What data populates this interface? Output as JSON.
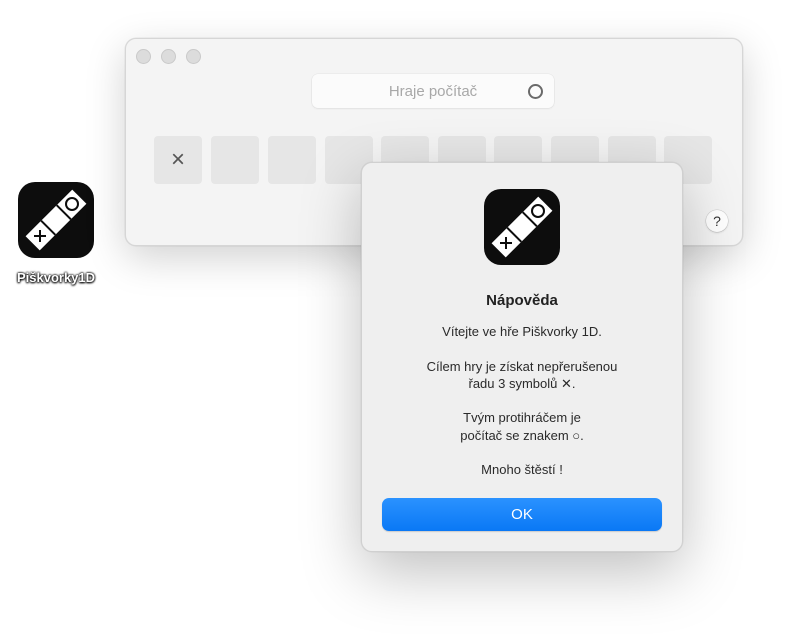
{
  "desktop": {
    "app_label": "Piškvorky1D",
    "app_icon": "piskvorky-app-icon"
  },
  "window": {
    "status_text": "Hraje počítač",
    "status_symbol": "circle-icon",
    "board": [
      "×",
      "",
      "",
      "",
      "",
      "",
      "",
      "",
      "",
      ""
    ],
    "help_label": "?"
  },
  "dialog": {
    "title": "Nápověda",
    "line1": "Vítejte ve hře Piškvorky 1D.",
    "line2": "Cílem hry je získat nepřerušenou",
    "line3": "řadu 3 symbolů ✕.",
    "line4": "Tvým protihráčem je",
    "line5": "počítač se znakem ○.",
    "line6": "Mnoho štěstí !",
    "ok_label": "OK"
  },
  "colors": {
    "accent": "#0a78f5",
    "window_bg": "#f4f4f4",
    "cell_bg": "#e6e6e6"
  }
}
